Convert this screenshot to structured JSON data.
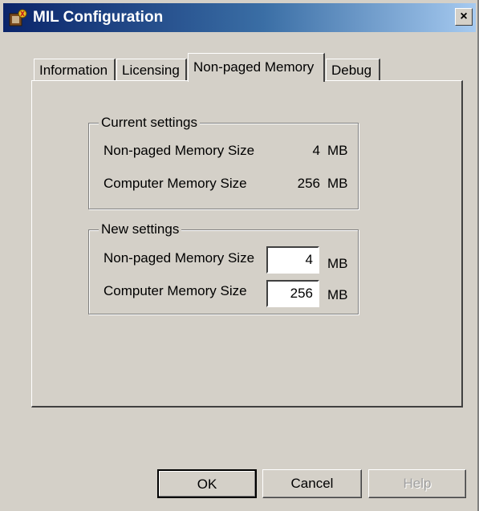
{
  "window": {
    "title": "MIL Configuration",
    "close_label": "×",
    "icon": "app-icon",
    "close_icon": "close-icon"
  },
  "tabs": [
    {
      "label": "Information",
      "active": false
    },
    {
      "label": "Licensing",
      "active": false
    },
    {
      "label": "Non-paged Memory",
      "active": true
    },
    {
      "label": "Debug",
      "active": false
    }
  ],
  "current_settings": {
    "legend": "Current settings",
    "rows": [
      {
        "label": "Non-paged Memory Size",
        "value": "4",
        "unit": "MB"
      },
      {
        "label": "Computer Memory Size",
        "value": "256",
        "unit": "MB"
      }
    ]
  },
  "new_settings": {
    "legend": "New settings",
    "rows": [
      {
        "label": "Non-paged Memory Size",
        "value": "4",
        "unit": "MB"
      },
      {
        "label": "Computer Memory Size",
        "value": "256",
        "unit": "MB"
      }
    ]
  },
  "buttons": {
    "ok": "OK",
    "cancel": "Cancel",
    "help": "Help"
  }
}
